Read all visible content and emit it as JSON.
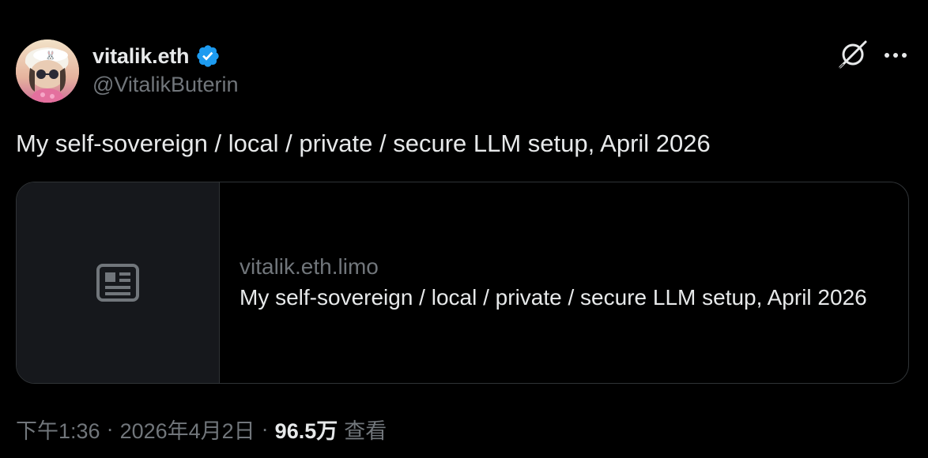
{
  "author": {
    "display_name": "vitalik.eth",
    "handle": "@VitalikButerin",
    "verified": true,
    "verified_color": "#1d9bf0"
  },
  "tweet": {
    "text": "My self-sovereign / local / private / secure LLM setup, April 2026"
  },
  "link_card": {
    "icon": "article-icon",
    "domain": "vitalik.eth.limo",
    "title": "My self-sovereign / local / private / secure LLM setup, April 2026"
  },
  "meta": {
    "time": "下午1:36",
    "separator": "·",
    "date": "2026年4月2日",
    "views_count": "96.5万",
    "views_label": "查看"
  },
  "actions": {
    "grok_icon": "grok-icon",
    "more_icon": "more-horizontal-icon"
  },
  "colors": {
    "background": "#000000",
    "text_primary": "#e7e9ea",
    "text_secondary": "#71767b",
    "border": "#2f3336",
    "card_thumb_bg": "#16181c"
  }
}
